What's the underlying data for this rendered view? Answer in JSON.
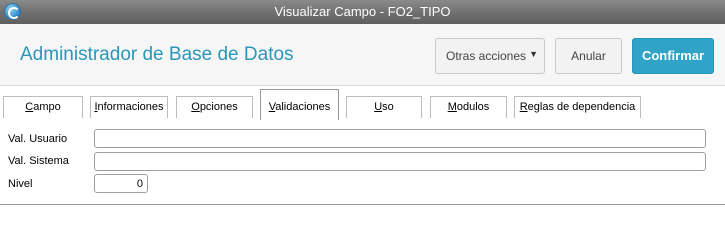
{
  "window": {
    "title": "Visualizar Campo - FO2_TIPO",
    "icon": "app-globe-icon"
  },
  "header": {
    "title": "Administrador de Base de Datos",
    "buttons": {
      "other_actions": "Otras acciones",
      "cancel": "Anular",
      "confirm": "Confirmar"
    },
    "accent_color": "#2fa4c6"
  },
  "tabs": [
    {
      "label": "Campo",
      "underline": "C",
      "rest": "ampo"
    },
    {
      "label": "Informaciones",
      "underline": "I",
      "rest": "nformaciones"
    },
    {
      "label": "Opciones",
      "underline": "O",
      "rest": "pciones"
    },
    {
      "label": "Validaciones",
      "underline": "V",
      "rest": "alidaciones",
      "active": true
    },
    {
      "label": "Uso",
      "underline": "U",
      "rest": "so"
    },
    {
      "label": "Modulos",
      "underline": "M",
      "rest": "odulos"
    },
    {
      "label": "Reglas de dependencia",
      "underline": "R",
      "rest": "eglas de dependencia"
    }
  ],
  "form": {
    "val_usuario": {
      "label": "Val. Usuario",
      "value": ""
    },
    "val_sistema": {
      "label": "Val. Sistema",
      "value": ""
    },
    "nivel": {
      "label": "Nivel",
      "value": "0"
    }
  }
}
